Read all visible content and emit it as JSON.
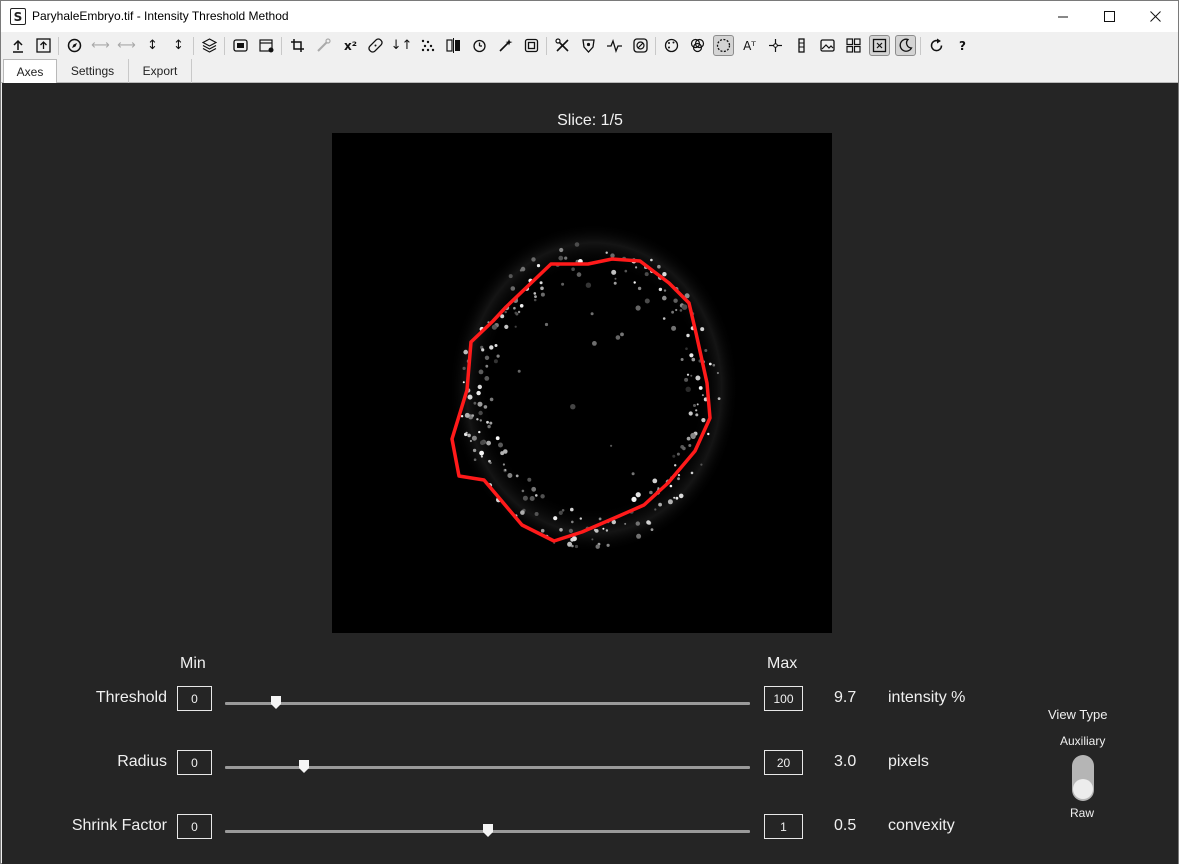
{
  "window": {
    "title": "ParyhaleEmbryo.tif - Intensity Threshold Method",
    "app_icon_letter": "S",
    "minimize_icon": "minimize-icon",
    "maximize_icon": "maximize-icon",
    "close_icon": "close-icon"
  },
  "toolbar": {
    "x_squared_label": "x²",
    "help_label": "?"
  },
  "tabs": [
    {
      "label": "Axes",
      "selected": true
    },
    {
      "label": "Settings",
      "selected": false
    },
    {
      "label": "Export",
      "selected": false
    }
  ],
  "viewer": {
    "slice_label": "Slice: 1/5"
  },
  "controls": {
    "min_label": "Min",
    "max_label": "Max",
    "params": [
      {
        "name": "Threshold",
        "min": "0",
        "max": "100",
        "value": "9.7",
        "unit": "intensity %",
        "fraction": 0.097
      },
      {
        "name": "Radius",
        "min": "0",
        "max": "20",
        "value": "3.0",
        "unit": "pixels",
        "fraction": 0.15
      },
      {
        "name": "Shrink Factor",
        "min": "0",
        "max": "1",
        "value": "0.5",
        "unit": "convexity",
        "fraction": 0.5
      }
    ]
  },
  "view_type": {
    "title": "View Type",
    "top_option": "Auxiliary",
    "bottom_option": "Raw",
    "selected": "Raw"
  },
  "colors": {
    "panel_background": "#252525",
    "outline": "#ff1a1a"
  }
}
